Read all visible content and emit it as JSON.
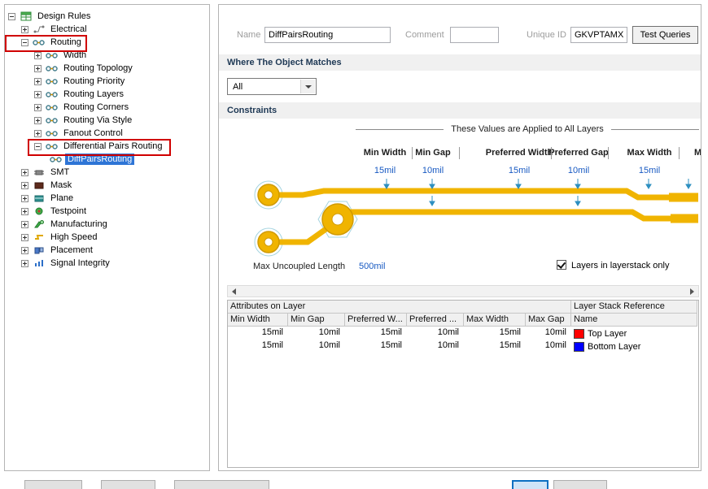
{
  "tree": {
    "items": [
      {
        "label": "Design Rules"
      },
      {
        "label": "Electrical"
      },
      {
        "label": "Routing"
      },
      {
        "label": "Width"
      },
      {
        "label": "Routing Topology"
      },
      {
        "label": "Routing Priority"
      },
      {
        "label": "Routing Layers"
      },
      {
        "label": "Routing Corners"
      },
      {
        "label": "Routing Via Style"
      },
      {
        "label": "Fanout Control"
      },
      {
        "label": "Differential Pairs Routing"
      },
      {
        "label": "DiffPairsRouting"
      },
      {
        "label": "SMT"
      },
      {
        "label": "Mask"
      },
      {
        "label": "Plane"
      },
      {
        "label": "Testpoint"
      },
      {
        "label": "Manufacturing"
      },
      {
        "label": "High Speed"
      },
      {
        "label": "Placement"
      },
      {
        "label": "Signal Integrity"
      }
    ]
  },
  "header": {
    "name_label": "Name",
    "name_value": "DiffPairsRouting",
    "comment_label": "Comment",
    "comment_value": "",
    "unique_id_label": "Unique ID",
    "unique_id_value": "GKVPTAMX",
    "test_queries": "Test Queries"
  },
  "where": {
    "title": "Where The Object Matches",
    "selected": "All"
  },
  "constraints": {
    "title": "Constraints",
    "applied_note": "These Values are Applied to All Layers",
    "dims": [
      {
        "label": "Min Width",
        "value": "15mil"
      },
      {
        "label": "Min Gap",
        "value": "10mil"
      },
      {
        "label": "Preferred Width",
        "value": "15mil"
      },
      {
        "label": "Preferred Gap",
        "value": "10mil"
      },
      {
        "label": "Max Width",
        "value": "15mil"
      },
      {
        "label": "M",
        "value": ""
      }
    ],
    "max_uncoupled_label": "Max Uncoupled Length",
    "max_uncoupled_value": "500mil",
    "layerstack_checkbox": "Layers in layerstack only"
  },
  "layer_table": {
    "group_left": "Attributes on Layer",
    "group_right": "Layer Stack Reference",
    "columns": [
      "Min Width",
      "Min Gap",
      "Preferred W...",
      "Preferred ...",
      "Max Width",
      "Max Gap",
      "Name"
    ],
    "rows": [
      {
        "c0": "15mil",
        "c1": "10mil",
        "c2": "15mil",
        "c3": "10mil",
        "c4": "15mil",
        "c5": "10mil",
        "name": "Top Layer",
        "swatch_style": "background:#FF0000"
      },
      {
        "c0": "15mil",
        "c1": "10mil",
        "c2": "15mil",
        "c3": "10mil",
        "c4": "15mil",
        "c5": "10mil",
        "name": "Bottom Layer",
        "swatch_style": "background:#0000FF"
      }
    ]
  },
  "colors": {
    "selection_blue": "#2E75D6",
    "annotation_red": "#D00000",
    "value_link_blue": "#1759C2",
    "trace_yellow": "#F0B400",
    "dimension_arrow_blue": "#2D8FC0",
    "top_layer_swatch": "#FF0000",
    "bottom_layer_swatch": "#0000FF"
  }
}
